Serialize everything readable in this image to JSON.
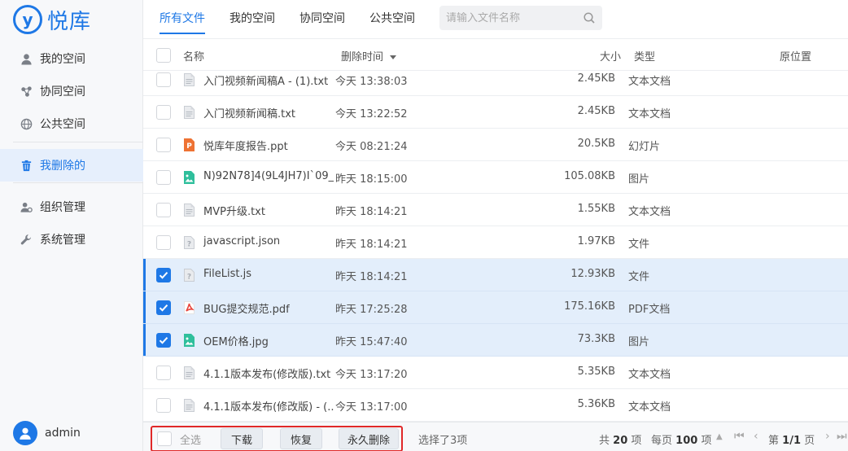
{
  "app": {
    "logo_mark": "y",
    "logo_text": "悦库",
    "brand_color": "#1e78e6"
  },
  "sidebar": {
    "items": [
      {
        "label": "我的空间",
        "icon": "person-icon"
      },
      {
        "label": "协同空间",
        "icon": "share-icon"
      },
      {
        "label": "公共空间",
        "icon": "globe-icon"
      },
      {
        "label": "我删除的",
        "icon": "trash-icon",
        "active": true
      },
      {
        "label": "组织管理",
        "icon": "users-gear-icon"
      },
      {
        "label": "系统管理",
        "icon": "wrench-icon"
      }
    ],
    "user": "admin"
  },
  "tabs": [
    {
      "label": "所有文件",
      "active": true
    },
    {
      "label": "我的空间"
    },
    {
      "label": "协同空间"
    },
    {
      "label": "公共空间"
    }
  ],
  "search": {
    "placeholder": "请输入文件名称",
    "value": ""
  },
  "table": {
    "columns": {
      "name": "名称",
      "deleted_time": "删除时间",
      "size": "大小",
      "type": "类型",
      "origin": "原位置"
    },
    "rows": [
      {
        "name": "入门视频新闻稿A - (1).txt",
        "time": "今天 13:38:03",
        "size": "2.45KB",
        "type": "文本文档",
        "icon": "txt",
        "checked": false
      },
      {
        "name": "入门视频新闻稿.txt",
        "time": "今天 13:22:52",
        "size": "2.45KB",
        "type": "文本文档",
        "icon": "txt",
        "checked": false
      },
      {
        "name": "悦库年度报告.ppt",
        "time": "今天 08:21:24",
        "size": "20.5KB",
        "type": "幻灯片",
        "icon": "ppt",
        "checked": false
      },
      {
        "name": "N)92N78]4(9L4JH7)I`09_...",
        "time": "昨天 18:15:00",
        "size": "105.08KB",
        "type": "图片",
        "icon": "img",
        "checked": false
      },
      {
        "name": "MVP升级.txt",
        "time": "昨天 18:14:21",
        "size": "1.55KB",
        "type": "文本文档",
        "icon": "txt",
        "checked": false
      },
      {
        "name": "javascript.json",
        "time": "昨天 18:14:21",
        "size": "1.97KB",
        "type": "文件",
        "icon": "unknown",
        "checked": false
      },
      {
        "name": "FileList.js",
        "time": "昨天 18:14:21",
        "size": "12.93KB",
        "type": "文件",
        "icon": "unknown",
        "checked": true
      },
      {
        "name": "BUG提交规范.pdf",
        "time": "昨天 17:25:28",
        "size": "175.16KB",
        "type": "PDF文档",
        "icon": "pdf",
        "checked": true
      },
      {
        "name": "OEM价格.jpg",
        "time": "昨天 15:47:40",
        "size": "73.3KB",
        "type": "图片",
        "icon": "img",
        "checked": true
      },
      {
        "name": "4.1.1版本发布(修改版).txt",
        "time": "今天 13:17:20",
        "size": "5.35KB",
        "type": "文本文档",
        "icon": "txt",
        "checked": false
      },
      {
        "name": "4.1.1版本发布(修改版) - (...",
        "time": "今天 13:17:00",
        "size": "5.36KB",
        "type": "文本文档",
        "icon": "txt",
        "checked": false
      }
    ]
  },
  "footer": {
    "select_all": "全选",
    "download": "下载",
    "restore": "恢复",
    "delete_forever": "永久删除",
    "selected_status": "选择了3项",
    "total_prefix": "共",
    "total_count": "20",
    "total_suffix": "项",
    "per_page_prefix": "每页",
    "per_page_count": "100",
    "per_page_suffix": "项",
    "page_prefix": "第",
    "page_value": "1/1",
    "page_suffix": "页"
  }
}
